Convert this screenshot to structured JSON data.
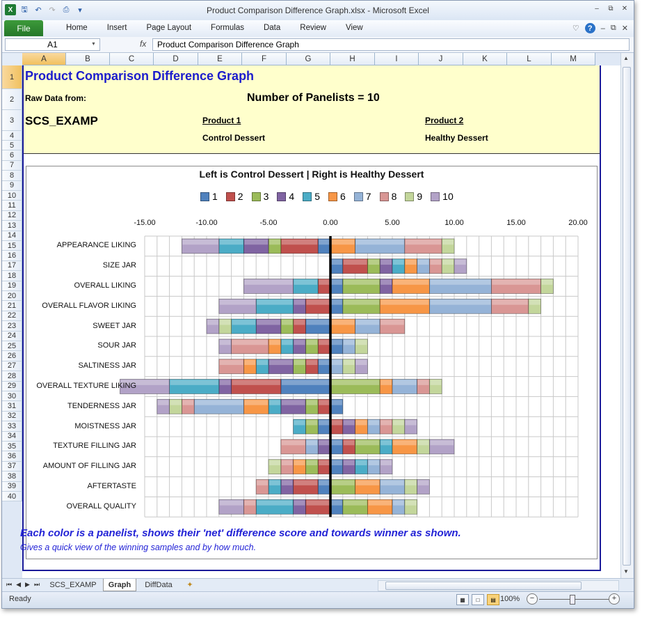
{
  "window": {
    "title": "Product Comparison Difference Graph.xlsx - Microsoft Excel"
  },
  "ribbon": {
    "file_label": "File",
    "tabs": [
      "Home",
      "Insert",
      "Page Layout",
      "Formulas",
      "Data",
      "Review",
      "View"
    ]
  },
  "formula_bar": {
    "name_box": "A1",
    "fx": "fx",
    "content": "Product Comparison Difference Graph"
  },
  "columns": [
    "A",
    "B",
    "C",
    "D",
    "E",
    "F",
    "G",
    "H",
    "I",
    "J",
    "K",
    "L",
    "M"
  ],
  "rows": [
    "1",
    "2",
    "3",
    "4",
    "5",
    "6",
    "7",
    "8",
    "9",
    "10",
    "11",
    "12",
    "13",
    "14",
    "15",
    "16",
    "17",
    "18",
    "19",
    "20",
    "21",
    "22",
    "23",
    "24",
    "25",
    "26",
    "27",
    "28",
    "29",
    "30",
    "31",
    "32",
    "33",
    "34",
    "35",
    "36",
    "37",
    "38",
    "39",
    "40"
  ],
  "sheet": {
    "title": "Product Comparison Difference Graph",
    "raw_data_label": "Raw Data from:",
    "panelists_label": "Number of Panelists = 10",
    "file_name": "SCS_EXAMP",
    "product1_label": "Product 1",
    "product1_name": "Control Dessert",
    "product2_label": "Product 2",
    "product2_name": "Healthy Dessert",
    "note1": "Each color is a panelist, shows their 'net' difference score and towards winner as shown.",
    "note2": "Gives a quick view of the winning samples and by how much."
  },
  "chart_data": {
    "type": "bar",
    "orientation": "horizontal",
    "stacked": true,
    "title": "Left is Control Dessert  |  Right is Healthy Dessert",
    "legend_position": "top",
    "xlim": [
      -15,
      20
    ],
    "xticks": [
      "-15.00",
      "-10.00",
      "-5.00",
      "0.00",
      "5.00",
      "10.00",
      "15.00",
      "20.00"
    ],
    "grid": true,
    "categories": [
      "APPEARANCE LIKING",
      "SIZE JAR",
      "OVERALL LIKING",
      "OVERALL FLAVOR LIKING",
      "SWEET JAR",
      "SOUR JAR",
      "SALTINESS JAR",
      "OVERALL TEXTURE LIKING",
      "TENDERNESS JAR",
      "MOISTNESS JAR",
      "TEXTURE FILLING JAR",
      "AMOUNT OF FILLING JAR",
      "AFTERTASTE",
      "OVERALL QUALITY"
    ],
    "series": [
      {
        "name": "1",
        "color": "#4f81bd",
        "values": [
          -1,
          1,
          1,
          1,
          -2,
          1,
          -1,
          -4,
          1,
          -1,
          1,
          1,
          -1,
          1
        ]
      },
      {
        "name": "2",
        "color": "#c0504d",
        "values": [
          -3,
          2,
          -1,
          -2,
          -1,
          -1,
          -1,
          -4,
          -1,
          1,
          1,
          -1,
          -2,
          -2
        ]
      },
      {
        "name": "3",
        "color": "#9bbb59",
        "values": [
          -1,
          1,
          3,
          3,
          -1,
          -1,
          -1,
          4,
          -1,
          -1,
          2,
          -1,
          2,
          2
        ]
      },
      {
        "name": "4",
        "color": "#8064a2",
        "values": [
          -2,
          1,
          1,
          -1,
          -2,
          -1,
          -2,
          -1,
          -2,
          1,
          -1,
          1,
          -1,
          -1
        ]
      },
      {
        "name": "5",
        "color": "#4bacc6",
        "values": [
          -2,
          1,
          -2,
          -3,
          -2,
          -1,
          -1,
          -4,
          -1,
          -1,
          1,
          1,
          -1,
          -3
        ]
      },
      {
        "name": "6",
        "color": "#f79646",
        "values": [
          2,
          1,
          3,
          4,
          2,
          -1,
          -1,
          1,
          -2,
          1,
          2,
          -1,
          2,
          2
        ]
      },
      {
        "name": "7",
        "color": "#95b3d7",
        "values": [
          4,
          1,
          5,
          5,
          2,
          1,
          1,
          2,
          -4,
          1,
          -1,
          1,
          2,
          1
        ]
      },
      {
        "name": "8",
        "color": "#d99694",
        "values": [
          3,
          1,
          4,
          3,
          2,
          -3,
          -2,
          1,
          -1,
          1,
          -2,
          -1,
          -1,
          -1
        ]
      },
      {
        "name": "9",
        "color": "#c3d69b",
        "values": [
          1,
          1,
          1,
          1,
          -1,
          1,
          1,
          1,
          -1,
          1,
          1,
          -1,
          1,
          1
        ]
      },
      {
        "name": "10",
        "color": "#b2a2c7",
        "values": [
          -3,
          1,
          -4,
          -3,
          -1,
          -1,
          1,
          -4,
          -1,
          1,
          2,
          1,
          1,
          -2
        ]
      }
    ]
  },
  "sheet_tabs": [
    "SCS_EXAMP",
    "Graph",
    "DiffData"
  ],
  "active_tab": "Graph",
  "status": {
    "ready": "Ready",
    "zoom": "100%"
  },
  "icons": {
    "excel": "excel-icon",
    "save": "save-icon",
    "undo": "undo-icon",
    "redo": "redo-icon",
    "help": "help-icon",
    "new_sheet": "insert-sheet-icon"
  }
}
